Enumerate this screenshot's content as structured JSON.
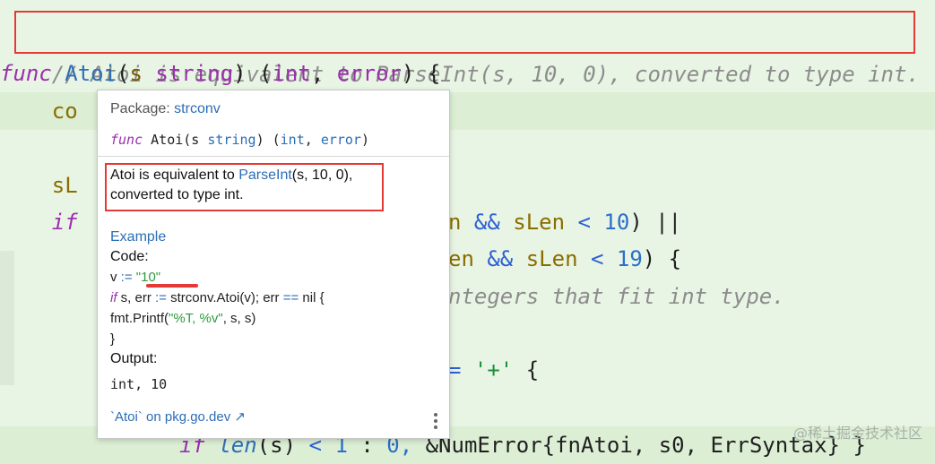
{
  "editor": {
    "comment_line": "// Atoi is equivalent to ParseInt(s, 10, 0), converted to type int.",
    "func_kw": "func",
    "func_name": "Atoi",
    "param": "s",
    "param_type": "string",
    "ret_int": "int",
    "ret_err": "error",
    "line3_visible": "co",
    "line5_visible": "sL",
    "line6_if": "if",
    "line6_tail_a": "n",
    "line6_tail_b": "&&",
    "line6_tail_c": "sLen",
    "line6_tail_d": "<",
    "line6_tail_e": "10",
    "line6_tail_f": ") ||",
    "line7_tail_a": "en",
    "line7_tail_b": "&&",
    "line7_tail_c": "sLen",
    "line7_tail_d": "<",
    "line7_tail_e": "19",
    "line7_tail_f": ") {",
    "line8_comment": "ntegers that fit int type.",
    "line10_op": "=",
    "line10_str": "'+'",
    "line10_brace": "{",
    "line12_if": "if",
    "line12_len": "len",
    "line12_s": "(s)",
    "line12_lt": "<",
    "line12_one": "1",
    "line12_colon": ":",
    "line12_zero": "0,",
    "line12_rest": "&NumError{fnAtoi, s0, ErrSyntax}",
    "line12_brace": "}"
  },
  "popup": {
    "package_label": "Package:",
    "package_name": "strconv",
    "sig_func": "func",
    "sig_name": "Atoi(s",
    "sig_string": "string",
    "sig_mid": ") (",
    "sig_int": "int",
    "sig_comma": ", ",
    "sig_error": "error",
    "sig_close": ")",
    "doc_a": "Atoi is equivalent to ",
    "doc_link": "ParseInt",
    "doc_b": "(s, 10, 0),",
    "doc_c": "converted to type int.",
    "example_heading": "Example",
    "code_label": "Code:",
    "code1_v": "v ",
    "code1_op": ":=",
    "code1_str": "\"10\"",
    "code2_if": "if",
    "code2_a": " s, err ",
    "code2_op": ":=",
    "code2_b": " strconv.Atoi(v); err ",
    "code2_eq": "==",
    "code2_c": " nil {",
    "code3_a": "fmt.Printf(",
    "code3_str": "\"%T, %v\"",
    "code3_b": ", s, s)",
    "code4": "}",
    "output_label": "Output:",
    "output_value": "int, 10",
    "ext_link": "`Atoi` on pkg.go.dev ↗"
  },
  "watermark": "@稀土掘金技术社区"
}
